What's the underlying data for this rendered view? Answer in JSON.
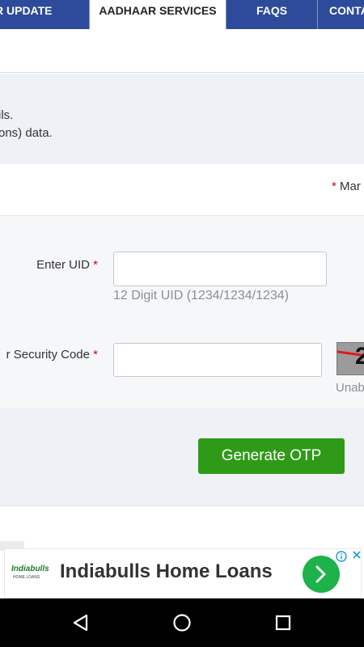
{
  "nav": {
    "tabs": [
      {
        "label": "R UPDATE"
      },
      {
        "label": "AADHAAR SERVICES"
      },
      {
        "label": "FAQS"
      },
      {
        "label": "CONTA"
      }
    ]
  },
  "info": {
    "line1": "ils.",
    "line2": "ons) data."
  },
  "mandatory": {
    "star": "*",
    "text": "Mar"
  },
  "form": {
    "uid": {
      "label": "Enter UID",
      "star": "*",
      "value": "",
      "hint": "12 Digit UID (1234/1234/1234)"
    },
    "security": {
      "label": "r Security Code",
      "star": "*",
      "value": "",
      "captcha_text": "2",
      "unable_text": "Unab"
    },
    "generate_otp_label": "Generate OTP"
  },
  "ad": {
    "logo_line1": "Indiabulls",
    "logo_line2": "HOME LOANS",
    "title": "Indiabulls Home Loans",
    "info_icon": "info-icon",
    "close_icon": "close-icon",
    "accent": "#1db34a"
  },
  "colors": {
    "nav_bg": "#2e4b9b",
    "button_green": "#2f9a18",
    "required_red": "#d0021b"
  }
}
